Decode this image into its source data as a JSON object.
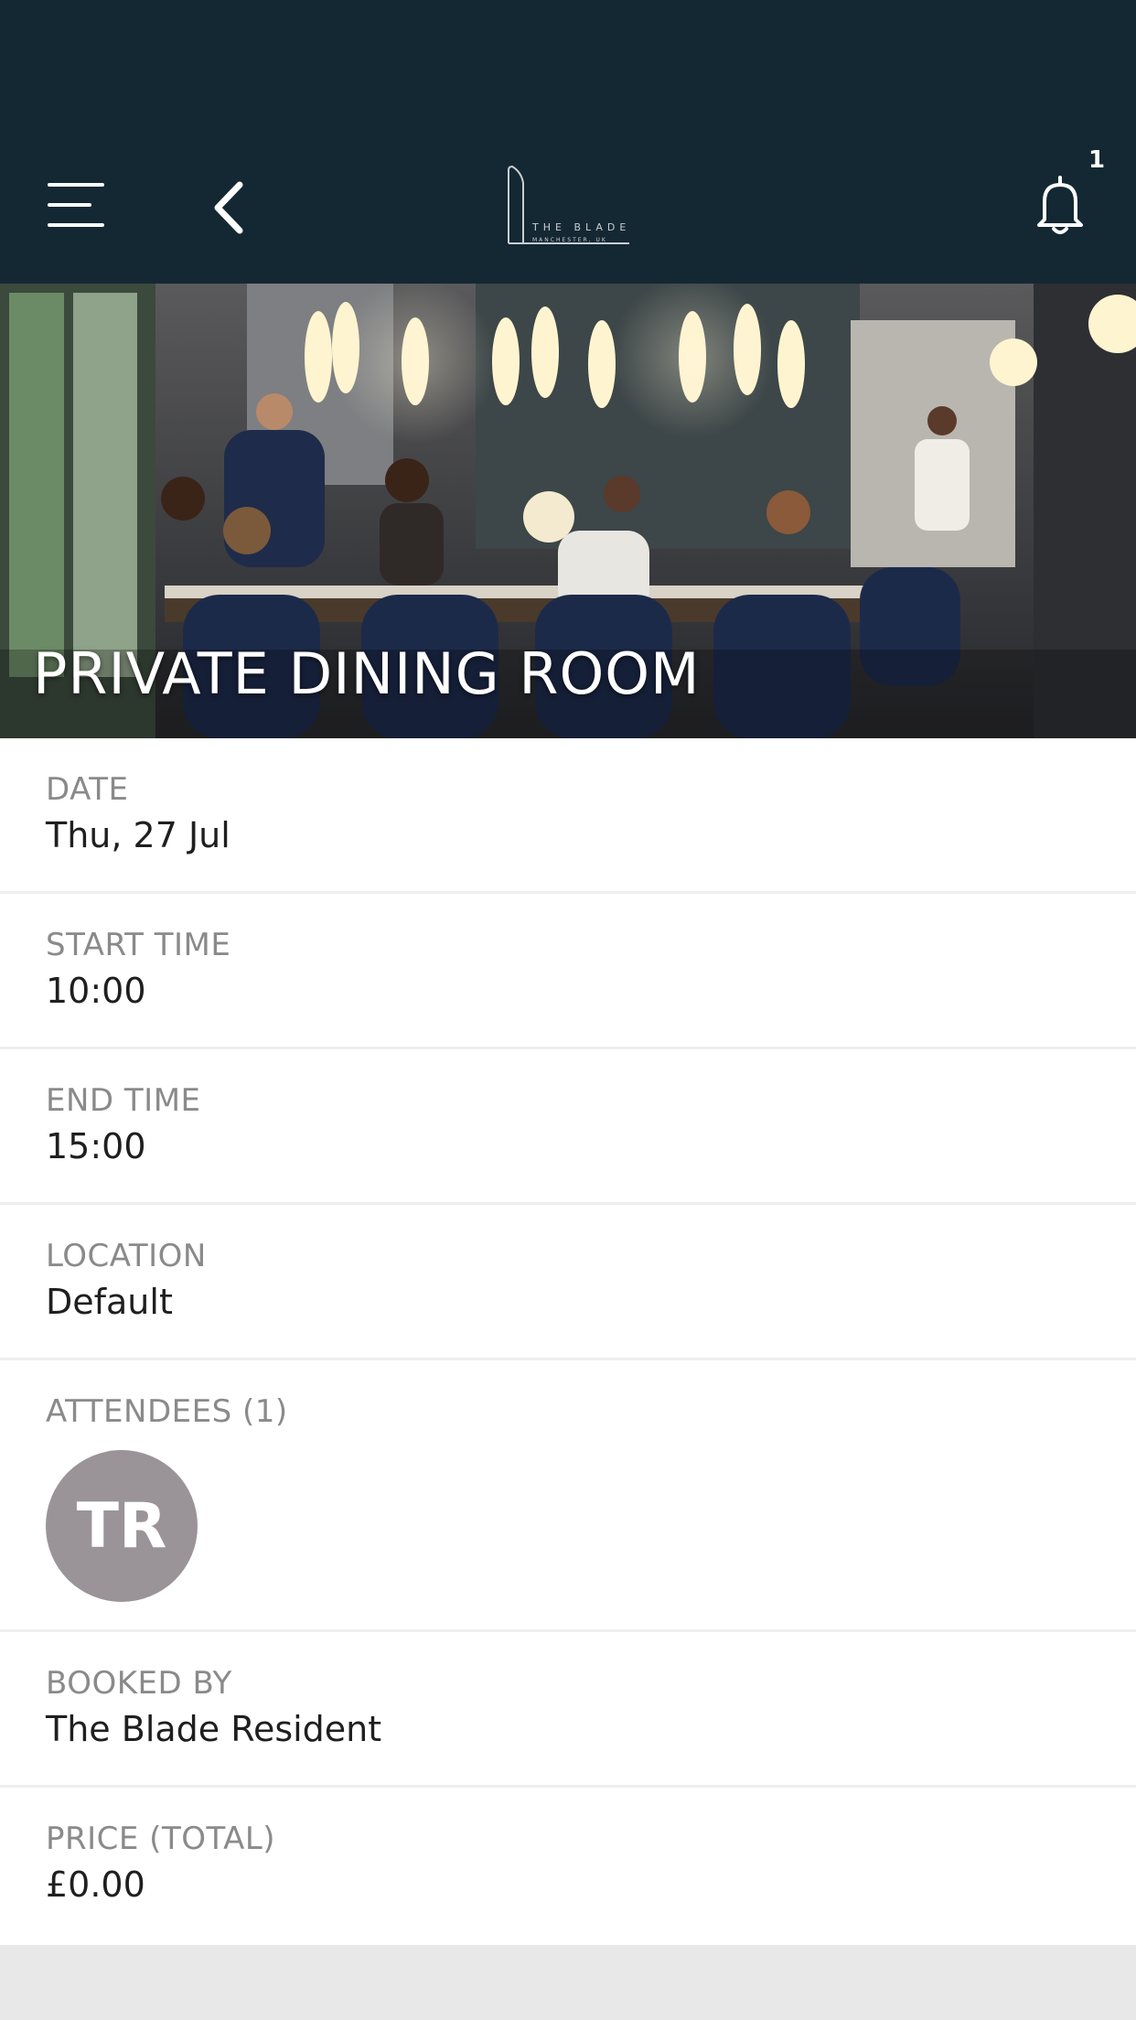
{
  "header": {
    "logo_text": "THE BLADE",
    "logo_subtext": "MANCHESTER, UK",
    "notification_count": "1",
    "icons": [
      "menu-icon",
      "back-icon",
      "bell-icon"
    ],
    "background_color": "#142833"
  },
  "hero": {
    "title": "PRIVATE DINING ROOM"
  },
  "details": [
    {
      "label": "DATE",
      "value": "Thu, 27 Jul"
    },
    {
      "label": "START TIME",
      "value": "10:00"
    },
    {
      "label": "END TIME",
      "value": "15:00"
    },
    {
      "label": "LOCATION",
      "value": "Default"
    }
  ],
  "attendees": {
    "label": "ATTENDEES (1)",
    "initials": "TR",
    "avatar_color": "#9a9499"
  },
  "booked_by": {
    "label": "BOOKED BY",
    "value": "The Blade Resident"
  },
  "price": {
    "label": "PRICE (TOTAL)",
    "value": "£0.00"
  }
}
